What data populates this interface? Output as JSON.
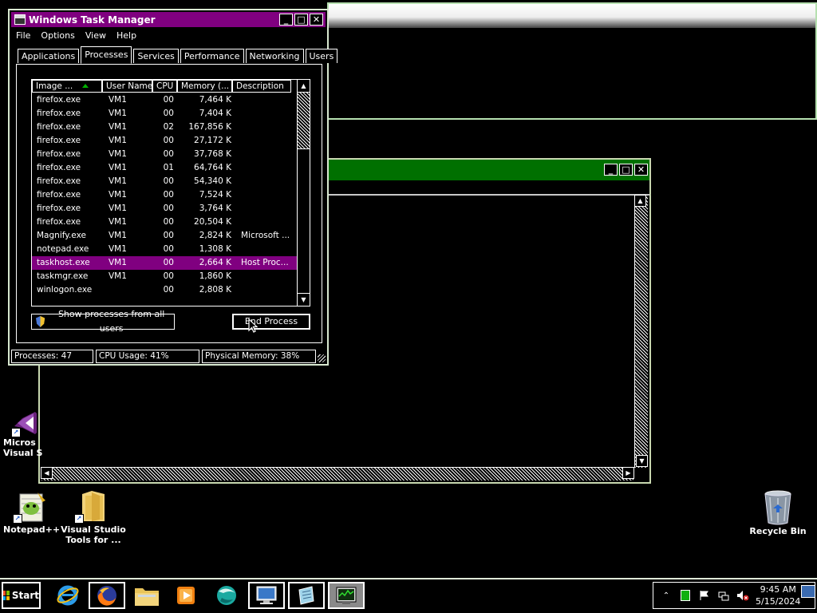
{
  "task_manager": {
    "title": "Windows Task Manager",
    "menu": [
      "File",
      "Options",
      "View",
      "Help"
    ],
    "tabs": [
      "Applications",
      "Processes",
      "Services",
      "Performance",
      "Networking",
      "Users"
    ],
    "active_tab": "Processes",
    "columns": [
      "Image ...",
      "User Name",
      "CPU",
      "Memory (...",
      "Description"
    ],
    "rows": [
      {
        "name": "firefox.exe",
        "user": "VM1",
        "cpu": "00",
        "mem": "7,464 K",
        "desc": ""
      },
      {
        "name": "firefox.exe",
        "user": "VM1",
        "cpu": "00",
        "mem": "7,404 K",
        "desc": ""
      },
      {
        "name": "firefox.exe",
        "user": "VM1",
        "cpu": "02",
        "mem": "167,856 K",
        "desc": ""
      },
      {
        "name": "firefox.exe",
        "user": "VM1",
        "cpu": "00",
        "mem": "27,172 K",
        "desc": ""
      },
      {
        "name": "firefox.exe",
        "user": "VM1",
        "cpu": "00",
        "mem": "37,768 K",
        "desc": ""
      },
      {
        "name": "firefox.exe",
        "user": "VM1",
        "cpu": "01",
        "mem": "64,764 K",
        "desc": ""
      },
      {
        "name": "firefox.exe",
        "user": "VM1",
        "cpu": "00",
        "mem": "54,340 K",
        "desc": ""
      },
      {
        "name": "firefox.exe",
        "user": "VM1",
        "cpu": "00",
        "mem": "7,524 K",
        "desc": ""
      },
      {
        "name": "firefox.exe",
        "user": "VM1",
        "cpu": "00",
        "mem": "3,764 K",
        "desc": ""
      },
      {
        "name": "firefox.exe",
        "user": "VM1",
        "cpu": "00",
        "mem": "20,504 K",
        "desc": ""
      },
      {
        "name": "Magnify.exe",
        "user": "VM1",
        "cpu": "00",
        "mem": "2,824 K",
        "desc": "Microsoft ..."
      },
      {
        "name": "notepad.exe",
        "user": "VM1",
        "cpu": "00",
        "mem": "1,308 K",
        "desc": ""
      },
      {
        "name": "taskhost.exe",
        "user": "VM1",
        "cpu": "00",
        "mem": "2,664 K",
        "desc": "Host Proc...",
        "selected": true
      },
      {
        "name": "taskmgr.exe",
        "user": "VM1",
        "cpu": "00",
        "mem": "1,860 K",
        "desc": ""
      },
      {
        "name": "winlogon.exe",
        "user": "",
        "cpu": "00",
        "mem": "2,808 K",
        "desc": ""
      }
    ],
    "show_all_label": "Show processes from all users",
    "end_process_label": "End Process",
    "status": {
      "processes": "Processes: 47",
      "cpu": "CPU Usage: 41%",
      "memory": "Physical Memory: 38%"
    }
  },
  "desktop_icons": {
    "visual_studio": "Micros\nVisual S",
    "notepadpp": "Notepad++",
    "vs_tools": "Visual Studio\nTools for ...",
    "recycle_bin": "Recycle Bin"
  },
  "taskbar": {
    "start_label": "Start",
    "apps": [
      "internet-explorer-icon",
      "firefox-icon",
      "file-explorer-icon",
      "media-player-icon",
      "browser-icon",
      "remote-desktop-icon",
      "notepad-icon",
      "task-manager-icon"
    ],
    "time": "9:45 AM",
    "date": "5/15/2024"
  },
  "colors": {
    "titlebar_active": "#800080",
    "selection": "#800080",
    "bg_window_title": "#007000"
  }
}
